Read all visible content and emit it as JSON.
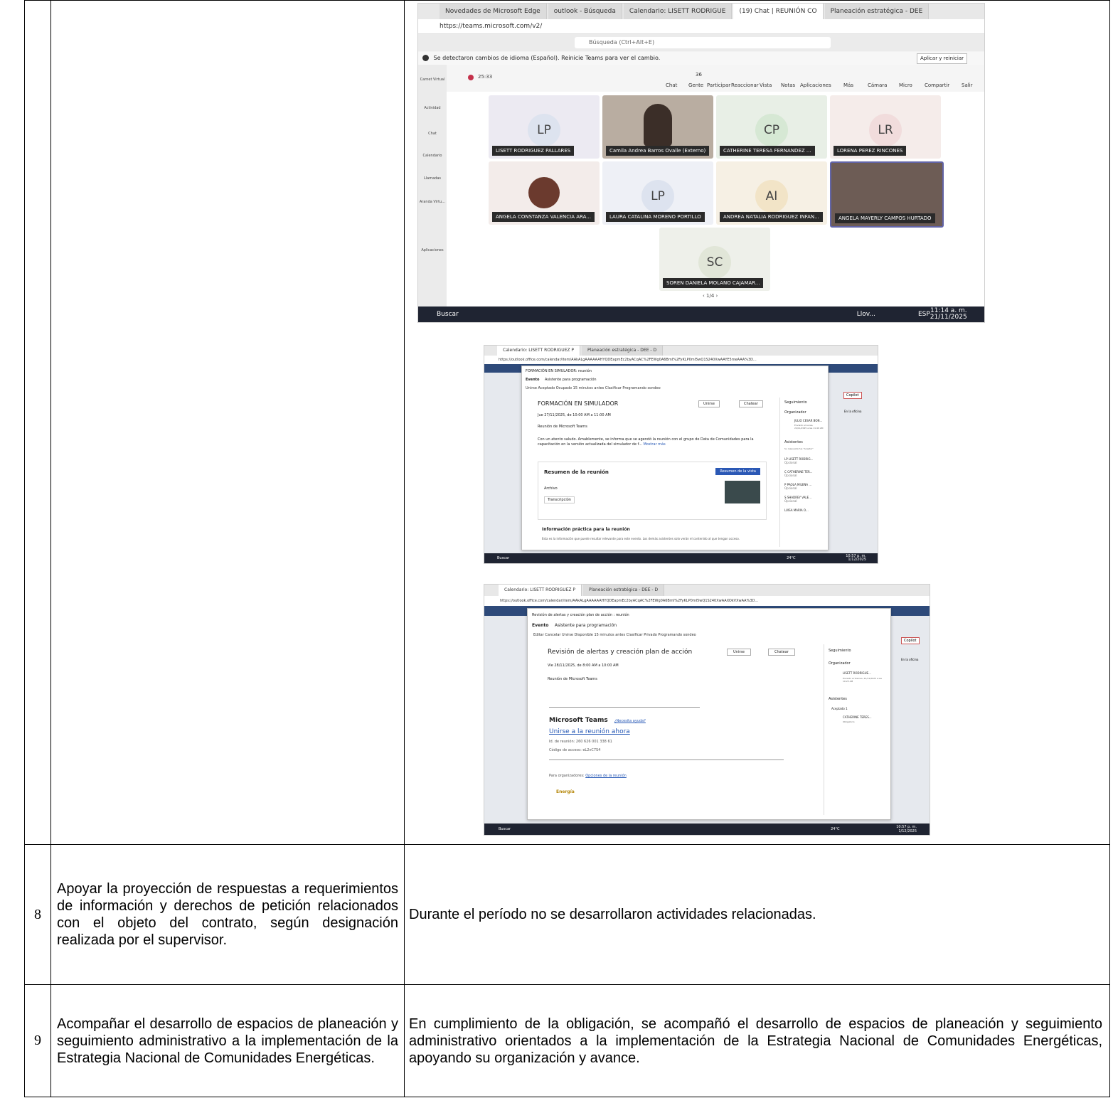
{
  "rows": [
    {
      "number": "",
      "description": "",
      "evidence": "",
      "screenshots": {
        "teams": {
          "tabs": [
            "Novedades de Microsoft Edge",
            "outlook - Búsqueda",
            "Calendario: LISETT RODRIGUE",
            "(19) Chat | REUNIÓN CO",
            "Planeación estratégica - DEE"
          ],
          "url": "https://teams.microsoft.com/v2/",
          "search_placeholder": "Búsqueda (Ctrl+Alt+E)",
          "banner": "Se detectaron cambios de idioma (Español). Reinicie Teams para ver el cambio.",
          "banner_button": "Aplicar y reiniciar",
          "timer": "25:33",
          "toolbar": [
            "Chat",
            "Gente",
            "Participar",
            "Reaccionar",
            "Vista",
            "Notas",
            "Aplicaciones",
            "Más",
            "Cámara",
            "Micro",
            "Compartir",
            "Salir"
          ],
          "people_count": "36",
          "rail": [
            "Carnet Virtual",
            "Actividad",
            "Chat",
            "Calendario",
            "Llamadas",
            "Aranda Virtu...",
            "Aplicaciones"
          ],
          "participants": [
            {
              "initials": "LP",
              "name": "LISETT RODRIGUEZ PALLARES"
            },
            {
              "initials": "",
              "name": "Camila Andrea Barros Ovalle (Externo)"
            },
            {
              "initials": "CP",
              "name": "CATHERINE TERESA FERNANDEZ ..."
            },
            {
              "initials": "LR",
              "name": "LORENA PEREZ RINCONES"
            },
            {
              "initials": "",
              "name": "ANGELA CONSTANZA VALENCIA ARA..."
            },
            {
              "initials": "LP",
              "name": "LAURA CATALINA MORENO PORTILLO"
            },
            {
              "initials": "AI",
              "name": "ANDREA NATALIA RODRIGUEZ INFAN..."
            },
            {
              "initials": "",
              "name": "ANGELA MAYERLY CAMPOS HURTADO"
            },
            {
              "initials": "SC",
              "name": "SOREN DANIELA MOLANO CAJAMAR..."
            }
          ],
          "pager": "‹  1/4  ›",
          "taskbar_search": "Buscar",
          "weather": "Llov...",
          "lang": "ESP",
          "clock_time": "11:14 a. m.",
          "clock_date": "21/11/2025"
        },
        "formacion": {
          "tabs": [
            "Calendario: LISETT RODRIGUEZ P",
            "Planeación estratégica - DEE - D"
          ],
          "url": "https://outlook.office.com/calendar/item/AAkALgAAAAAAHYQDEapmEc2byACqAC%2FEWg0A6BmI%2FyKLP0mI5wQ1S240XwAAYE5meAAA%3D...",
          "dialog_title": "FORMACIÓN EN SIMULADOR: reunión",
          "tabs_inner": [
            "Evento",
            "Asistente para programación"
          ],
          "actions": "Unirse   Aceptado   Ocupado   15 minutos antes   Clasificar   Programando sondeo",
          "event_title": "FORMACIÓN EN SIMULADOR",
          "join": "Unirse",
          "chat": "Chatear",
          "datetime": "Jue 27/11/2025, de 10:00 AM a 11:00 AM",
          "location": "Reunión de Microsoft Teams",
          "body": "Con un atento saludo. Amablemente, se informa que se agendó la reunión con el grupo de Data de Comunidades para la capacitación en la versión actualizada del simulador de f...",
          "show_more": "Mostrar más",
          "summary_title": "Resumen de la reunión",
          "summary_button": "Resumen de la vista",
          "files_label": "Archivo",
          "transcript": "Transcripción",
          "info_title": "Información práctica para la reunión",
          "info_text": "Esta es la información que puede resultar relevante para este evento. Los demás asistentes solo verán el contenido al que tengan acceso.",
          "tracking": "Seguimiento",
          "organizer_label": "Organizador",
          "organizer": "JULIO CESAR BON...",
          "organizer_sent": "Enviado el Lunes, 24/11/2025 a las 11:49 AM",
          "attendees_label": "Asistentes",
          "response": "Su respuesta fue \"Aceptar\"",
          "attendees": [
            {
              "initials": "LP",
              "name": "LISETT RODRIG...",
              "role": "Opcional"
            },
            {
              "initials": "C",
              "name": "CATHERINE TER...",
              "role": "Opcional"
            },
            {
              "initials": "P",
              "name": "PAOLA MILENA ...",
              "role": "Opcional"
            },
            {
              "initials": "S",
              "name": "SHADREY VALE...",
              "role": "Opcional"
            },
            {
              "initials": "",
              "name": "LUISA MARIA O...",
              "role": ""
            }
          ],
          "copilot": "Copilot",
          "office": "En la oficina",
          "weather": "24°C",
          "clock_time": "10:57 p. m.",
          "clock_date": "1/12/2025"
        },
        "revision": {
          "tabs": [
            "Calendario: LISETT RODRIGUEZ P",
            "Planeación estratégica - DEE - D"
          ],
          "url": "https://outlook.office.com/calendar/item/AAkALgAAAAAAHYQDEapmEc2byACqAC%2FEWg0A6BmI%2FyKLP0mI5wQ1S240XwAAXOkVXwAA%3D...",
          "dialog_title": "Revisión de alertas y creación plan de acción : reunión",
          "tabs_inner": [
            "Evento",
            "Asistente para programación"
          ],
          "actions": "Editar   Cancelar   Unirse   Disponible   15 minutos antes   Clasificar   Privado   Programando sondeo",
          "event_title": "Revisión de alertas y creación plan de acción",
          "join": "Unirse",
          "chat": "Chatear",
          "datetime": "Vie 28/11/2025, de 8:00 AM a 10:00 AM",
          "location": "Reunión de Microsoft Teams",
          "teams_heading": "Microsoft Teams",
          "help": "¿Necesita ayuda?",
          "join_link": "Unirse a la reunión ahora",
          "meeting_id": "Id. de reunión: 260 626 001 338 61",
          "passcode": "Código de acceso: eL2vC7S4",
          "organizers": "Para organizadores:",
          "options": "Opciones de la reunión",
          "brand": "Energía",
          "tracking": "Seguimiento",
          "organizer_label": "Organizador",
          "organizer": "LISETT RODRIGUE...",
          "organizer_sent": "Enviado el Viernes, 21/11/2025 a las 10:23 AM",
          "attendees_label": "Asistentes",
          "accepted": "Aceptado 1",
          "attendee": "CATHERINE TERES...",
          "attendee_role": "Obligatorio",
          "copilot": "Copilot",
          "office": "En la oficina",
          "weather": "24°C",
          "clock_time": "10:57 p. m.",
          "clock_date": "1/12/2025"
        }
      }
    },
    {
      "number": "8",
      "description": "Apoyar la proyección de respuestas a requerimientos de información y derechos de petición relacionados con el objeto del contrato, según designación realizada por el supervisor.",
      "evidence": "Durante el período no se desarrollaron actividades relacionadas."
    },
    {
      "number": "9",
      "description": "Acompañar el desarrollo de espacios de planeación y seguimiento administrativo a la implementación de la Estrategia Nacional de Comunidades Energéticas.",
      "evidence": "En cumplimiento de la obligación, se acompañó el desarrollo de espacios de planeación y seguimiento administrativo orientados a la implementación de la Estrategia Nacional de Comunidades Energéticas, apoyando su organización y avance."
    }
  ]
}
